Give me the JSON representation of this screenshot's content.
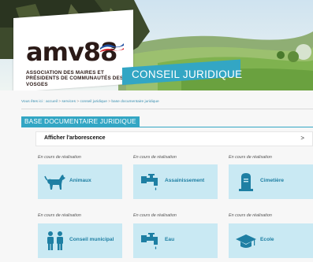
{
  "header": {
    "logo_text": "amv88",
    "logo_subtitle": "Association des maires et présidents de communautés des Vosges",
    "section_banner": "CONSEIL JURIDIQUE"
  },
  "breadcrumb": {
    "prefix": "Vous êtes ici :",
    "items": [
      "accueil",
      "services",
      "conseil juridique",
      "base documentaire juridique"
    ],
    "separator": ">"
  },
  "page_title": "BASE DOCUMENTAIRE JURIDIQUE",
  "tree_toggle": {
    "label": "Afficher l'arborescence",
    "arrow": ">"
  },
  "categories": [
    {
      "status": "En cours de réalisation",
      "label": "Animaux",
      "icon": "dog-icon"
    },
    {
      "status": "En cours de réalisation",
      "label": "Assainissement",
      "icon": "faucet-icon"
    },
    {
      "status": "En cours de réalisation",
      "label": "Cimetière",
      "icon": "tombstone-icon"
    },
    {
      "status": "En cours de réalisation",
      "label": "Conseil municipal",
      "icon": "people-icon"
    },
    {
      "status": "En cours de réalisation",
      "label": "Eau",
      "icon": "faucet-icon"
    },
    {
      "status": "En cours de réalisation",
      "label": "Ecole",
      "icon": "graduation-cap-icon"
    }
  ],
  "colors": {
    "accent": "#33a6c4",
    "tile_bg": "#c9e9f3",
    "tile_text": "#1e7fa3",
    "logo_dark": "#2b1a17"
  }
}
